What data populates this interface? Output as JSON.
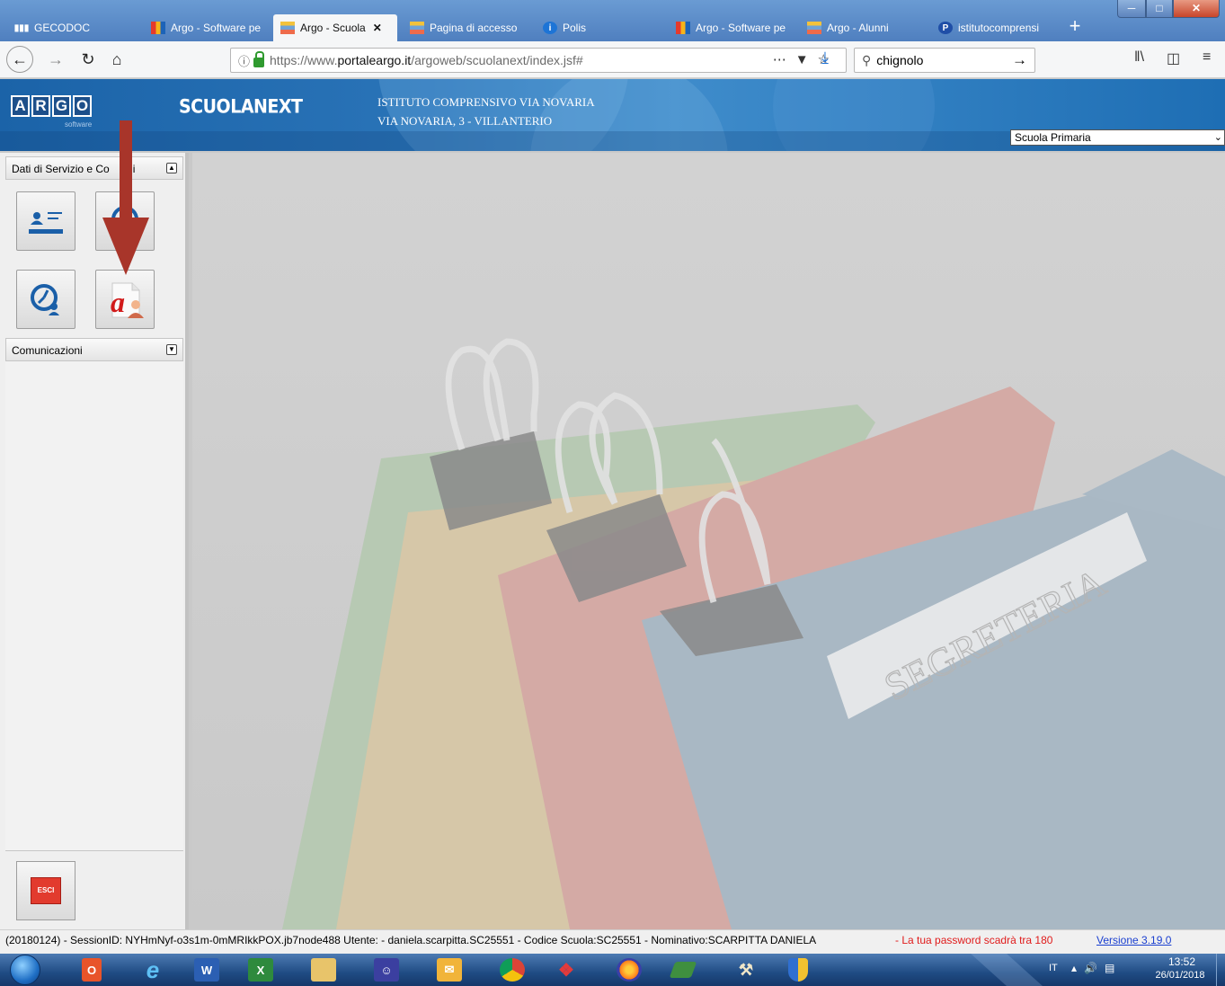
{
  "browser": {
    "tabs": [
      {
        "label": "GECODOC",
        "favicon": "gecodoc-icon",
        "active": false
      },
      {
        "label": "Argo - Software pe",
        "favicon": "argo-icon",
        "active": false
      },
      {
        "label": "Argo - Scuola",
        "favicon": "argo-bars-icon",
        "active": true
      },
      {
        "label": "Pagina di accesso",
        "favicon": "argo-bars-icon",
        "active": false
      },
      {
        "label": "Polis",
        "favicon": "info-icon",
        "active": false
      },
      {
        "label": "Argo - Software pe",
        "favicon": "argo-icon",
        "active": false
      },
      {
        "label": "Argo - Alunni",
        "favicon": "argo-bars-icon",
        "active": false
      },
      {
        "label": "istitutocomprensi",
        "favicon": "p-icon",
        "active": false
      }
    ],
    "url": {
      "prefix": "https://www.",
      "host": "portaleargo.it",
      "path": "/argoweb/scuolanext/index.jsf#"
    },
    "search_value": "chignolo"
  },
  "header": {
    "logo_letters": [
      "A",
      "R",
      "G",
      "O"
    ],
    "logo_sub": "software",
    "product": "SCUOLANEXT",
    "school_name": "ISTITUTO COMPRENSIVO VIA NOVARIA",
    "school_address": "VIA NOVARIA, 3 - VILLANTERIO",
    "school_select": "Scuola Primaria"
  },
  "sidebar": {
    "panel1_title": "Dati di Servizio e Co",
    "panel1_title_tail": "bili",
    "panel2_title": "Comunicazioni",
    "exit_label": "ESCI"
  },
  "main": {
    "stamp_text": "SEGRETERIA"
  },
  "status": {
    "session": "(20180124) - SessionID: NYHmNyf-o3s1m-0mMRIkkPOX.jb7node488 Utente: - daniela.scarpitta.SC25551 - Codice Scuola:SC25551 - Nominativo:SCARPITTA DANIELA",
    "warning": "- La tua password scadrà tra 180",
    "version": "Versione 3.19.0"
  },
  "taskbar": {
    "lang": "IT",
    "time": "13:52",
    "date": "26/01/2018"
  },
  "colors": {
    "header_blue": "#1b63a8",
    "arrow_red": "#a8352a",
    "warning_red": "#e01b1b",
    "link_blue": "#1a3fd0"
  }
}
